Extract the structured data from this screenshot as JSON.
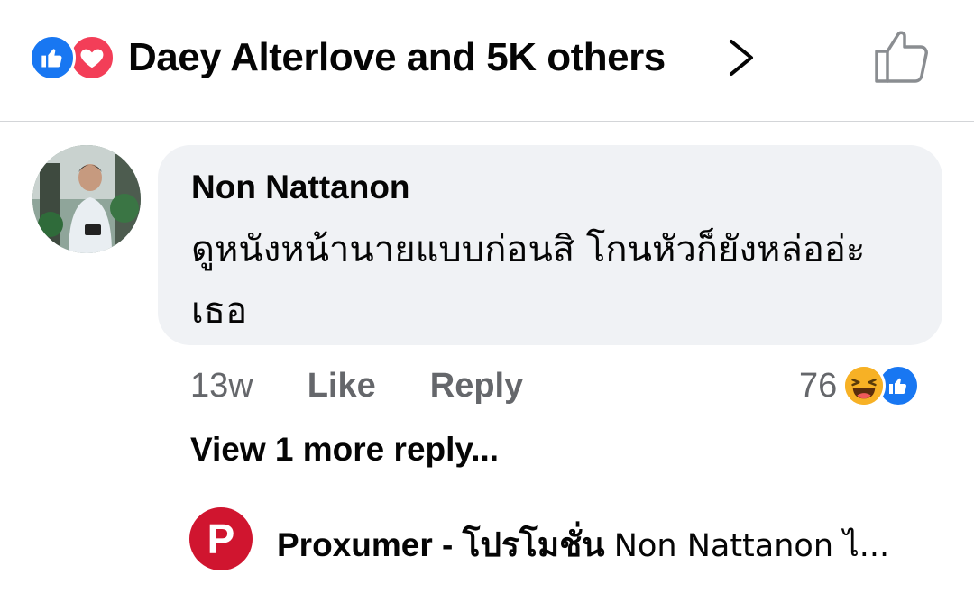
{
  "header": {
    "summary": "Daey Alterlove and 5K others",
    "reactions": [
      "like-icon",
      "love-icon"
    ]
  },
  "comment": {
    "author": "Non Nattanon",
    "text": "ดูหนังหน้านายแบบก่อนสิ โกนหัวก็ยังหล่ออ่ะเธอ",
    "time": "13w",
    "like_label": "Like",
    "reply_label": "Reply",
    "reaction_count": "76",
    "reaction_icons": [
      "haha-icon",
      "like-icon"
    ]
  },
  "view_more": "View 1 more reply...",
  "reply": {
    "avatar_letter": "P",
    "author": "Proxumer - โปรโมชั่น",
    "snippet": "Non Nattanon ไ..."
  },
  "colors": {
    "like_blue": "#1877f2",
    "love_red": "#f33e58",
    "haha_yellow": "#f7b125",
    "secondary_text": "#65676b",
    "bubble_bg": "#f0f2f5"
  }
}
